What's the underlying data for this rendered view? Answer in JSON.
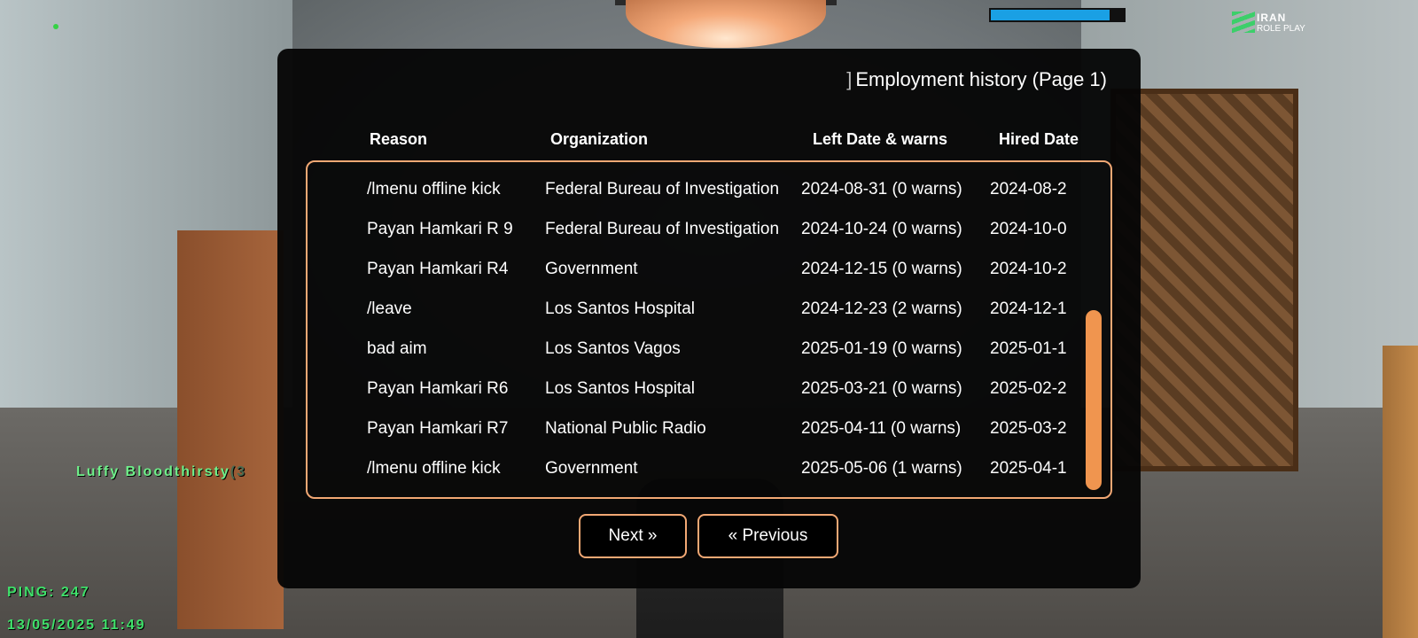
{
  "hud": {
    "health_fraction": 0.89,
    "logo_line1": "IRAN",
    "logo_line2": "ROLE PLAY",
    "nametag": "Luffy Bloodthirsty",
    "nametag_extra": "(3",
    "ping": "PING: 247",
    "datetime": "13/05/2025 11:49"
  },
  "dialog": {
    "title_bracket": "]",
    "title": "Employment history (Page 1)",
    "columns": {
      "reason": "Reason",
      "organization": "Organization",
      "left_date": "Left Date & warns",
      "hired_date": "Hired Date"
    },
    "rows": [
      {
        "reason": "/lmenu offline kick",
        "organization": "Federal Bureau of Investigation",
        "left": "2024-08-31 (0 warns)",
        "hired": "2024-08-2"
      },
      {
        "reason": "Payan Hamkari R 9",
        "organization": "Federal Bureau of Investigation",
        "left": "2024-10-24 (0 warns)",
        "hired": "2024-10-0"
      },
      {
        "reason": "Payan Hamkari R4",
        "organization": "Government",
        "left": "2024-12-15 (0 warns)",
        "hired": "2024-10-2"
      },
      {
        "reason": "/leave",
        "organization": "Los Santos Hospital",
        "left": "2024-12-23 (2 warns)",
        "hired": "2024-12-1"
      },
      {
        "reason": "bad aim",
        "organization": "Los Santos Vagos",
        "left": "2025-01-19 (0 warns)",
        "hired": "2025-01-1"
      },
      {
        "reason": "Payan Hamkari R6",
        "organization": "Los Santos Hospital",
        "left": "2025-03-21 (0 warns)",
        "hired": "2025-02-2"
      },
      {
        "reason": "Payan Hamkari R7",
        "organization": "National Public Radio",
        "left": "2025-04-11 (0 warns)",
        "hired": "2025-03-2"
      },
      {
        "reason": "/lmenu offline kick",
        "organization": "Government",
        "left": "2025-05-06 (1 warns)",
        "hired": "2025-04-1"
      }
    ],
    "scroll": {
      "start_fraction": 0.44,
      "size_fraction": 0.56
    },
    "buttons": {
      "next": "Next »",
      "previous": "« Previous"
    }
  },
  "colors": {
    "accent": "#f2a874",
    "scrollbar": "#f0954f",
    "hud_green": "#3fe06a",
    "health_bar": "#1aa0e4"
  }
}
